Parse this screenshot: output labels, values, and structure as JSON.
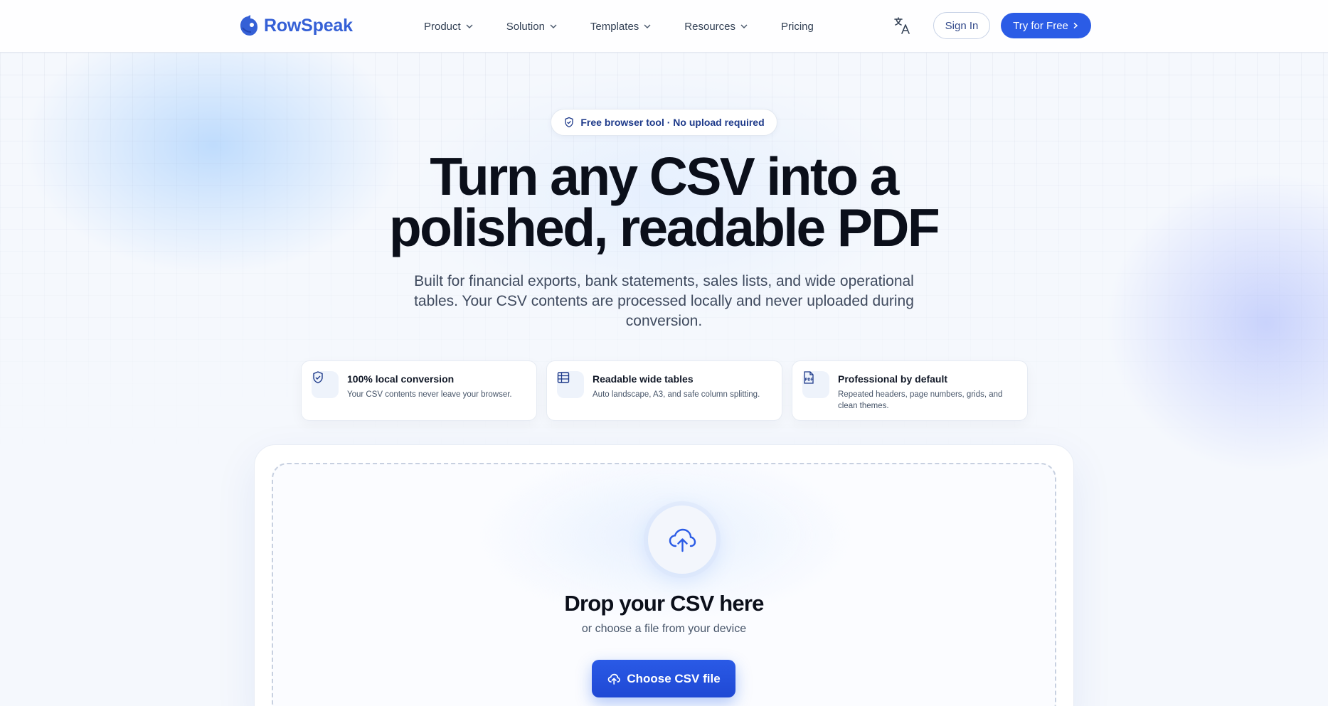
{
  "brand": {
    "name": "RowSpeak",
    "accent": "#2b5ce6",
    "logo_color": "#3560d6"
  },
  "nav": {
    "items": [
      {
        "label": "Product",
        "has_dropdown": true
      },
      {
        "label": "Solution",
        "has_dropdown": true
      },
      {
        "label": "Templates",
        "has_dropdown": true
      },
      {
        "label": "Resources",
        "has_dropdown": true
      },
      {
        "label": "Pricing",
        "has_dropdown": false
      }
    ],
    "language_icon": "translate-icon",
    "sign_in": "Sign In",
    "cta": "Try for Free"
  },
  "hero": {
    "badge": "Free browser tool · No upload required",
    "badge_icon": "shield-check-icon",
    "title_line1": "Turn any CSV into a",
    "title_line2": "polished, readable PDF",
    "subtitle": "Built for financial exports, bank statements, sales lists, and wide operational tables. Your CSV contents are processed locally and never uploaded during conversion."
  },
  "features": [
    {
      "icon": "shield-check-icon",
      "title": "100% local conversion",
      "description": "Your CSV contents never leave your browser."
    },
    {
      "icon": "table-icon",
      "title": "Readable wide tables",
      "description": "Auto landscape, A3, and safe column splitting."
    },
    {
      "icon": "pdf-file-icon",
      "title": "Professional by default",
      "description": "Repeated headers, page numbers, grids, and clean themes."
    }
  ],
  "upload": {
    "icon": "cloud-upload-icon",
    "title": "Drop your CSV here",
    "subtitle": "or choose a file from your device",
    "button": "Choose CSV file"
  }
}
